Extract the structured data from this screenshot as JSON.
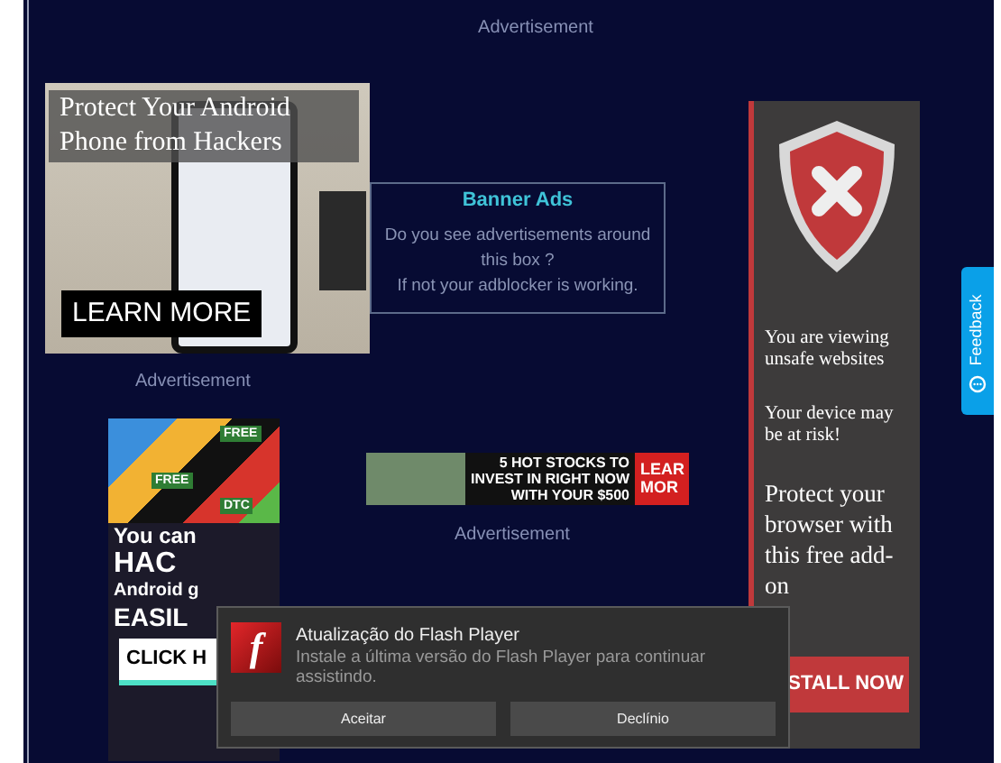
{
  "top_label": "Advertisement",
  "android_ad": {
    "headline": "Protect Your Android Phone from Hackers",
    "button": "LEARN MORE"
  },
  "banner_box": {
    "title": "Banner Ads",
    "lines": [
      "Do you see advertisements around this box ?",
      "If not your adblocker is working."
    ]
  },
  "android_ad_label": "Advertisement",
  "hack_ad": {
    "badges": [
      "FREE",
      "FREE",
      "DTC"
    ],
    "lines": [
      "You can",
      "HAC",
      "Android g",
      "EASIL"
    ],
    "button": "CLICK H"
  },
  "stocks_ad": {
    "lines": [
      "5 HOT STOCKS TO",
      "INVEST IN RIGHT NOW",
      "WITH YOUR $500"
    ],
    "button_lines": [
      "LEAR",
      "MOR"
    ]
  },
  "stocks_ad_label": "Advertisement",
  "shield_ad": {
    "warning": "You are viewing unsafe websites",
    "risk": "Your device may be at risk!",
    "pitch": "Protect your browser with this free add-on",
    "button": "STALL NOW"
  },
  "feedback_tab": {
    "label": "Feedback"
  },
  "popup": {
    "icon_glyph": "f",
    "title": "Atualização do Flash Player",
    "message": "Instale a última versão do Flash Player para continuar assistindo.",
    "buttons": [
      "Aceitar",
      "Declínio"
    ]
  }
}
